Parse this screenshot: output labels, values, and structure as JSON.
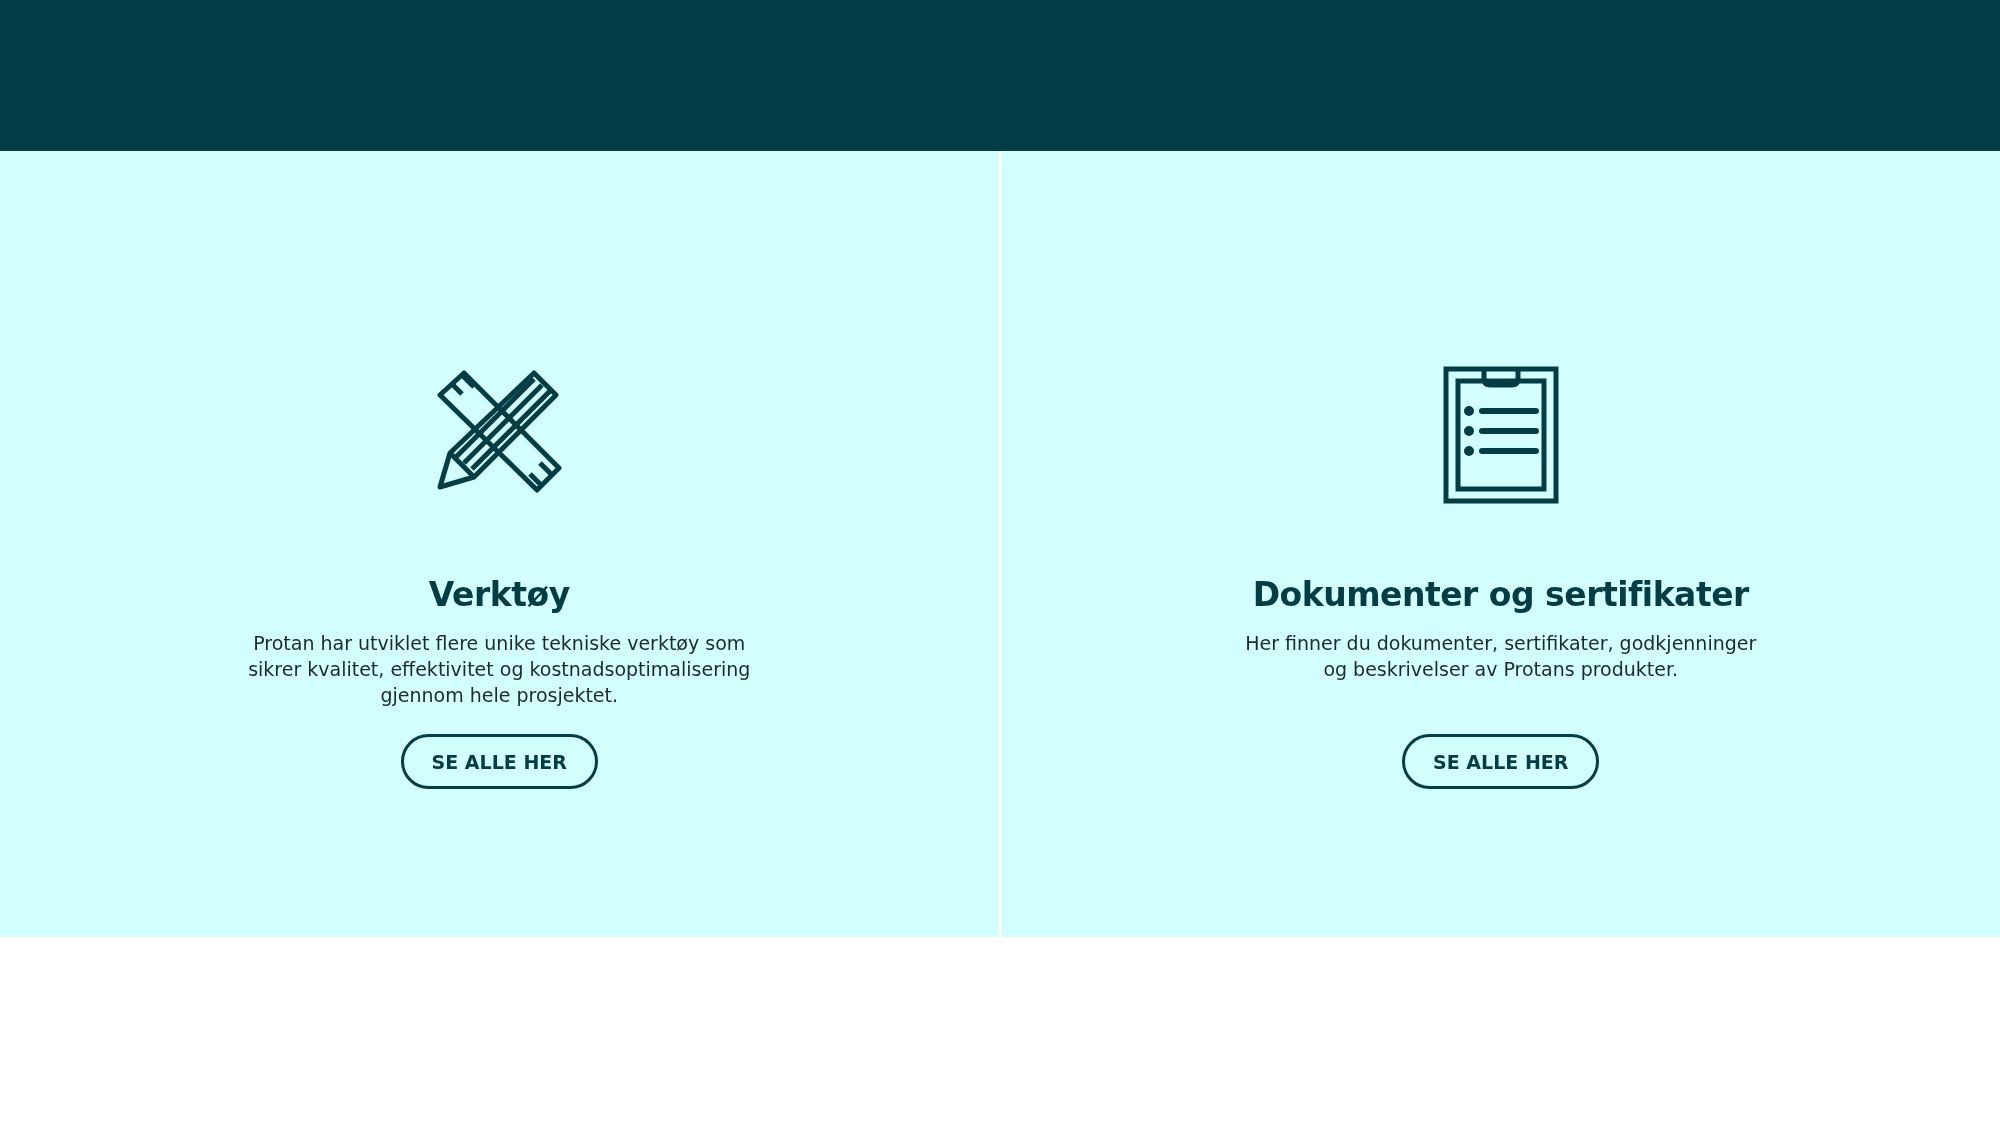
{
  "cards": [
    {
      "kind": "tools",
      "title": "Verktøy",
      "text": "Protan har utviklet flere unike tekniske verktøy som sikrer kvalitet, effektivitet og kostnadsoptimalisering gjennom hele prosjektet.",
      "button": "SE ALLE HER"
    },
    {
      "kind": "clipboard",
      "title": "Dokumenter og sertifikater",
      "text": "Her finner du dokumenter, sertifikater, godkjenninger og beskrivelser av Protans produkter.",
      "button": "SE ALLE HER"
    }
  ]
}
